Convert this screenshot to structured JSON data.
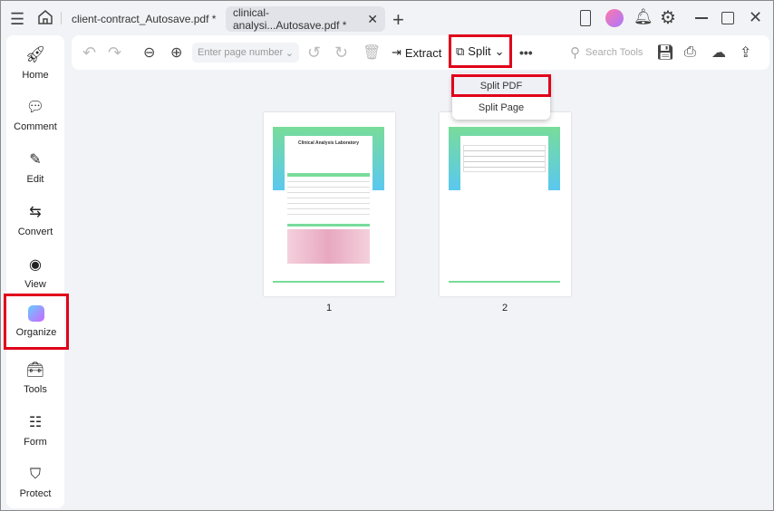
{
  "tabs": [
    {
      "label": "client-contract_Autosave.pdf *"
    },
    {
      "label": "clinical-analysi...Autosave.pdf *"
    }
  ],
  "sidebar": {
    "items": [
      {
        "label": "Home"
      },
      {
        "label": "Comment"
      },
      {
        "label": "Edit"
      },
      {
        "label": "Convert"
      },
      {
        "label": "View"
      },
      {
        "label": "Organize"
      },
      {
        "label": "Tools"
      },
      {
        "label": "Form"
      },
      {
        "label": "Protect"
      }
    ]
  },
  "toolbar": {
    "page_placeholder": "Enter page number",
    "extract": "Extract",
    "split": "Split",
    "search_placeholder": "Search Tools"
  },
  "dropdown": {
    "items": [
      "Split PDF",
      "Split Page"
    ]
  },
  "pages": [
    {
      "number": "1",
      "title": "Clinical Analysis Laboratory"
    },
    {
      "number": "2"
    }
  ],
  "colors": {
    "accent": "#e0001a",
    "green": "#78dc9a",
    "blue": "#5ac8f0"
  }
}
